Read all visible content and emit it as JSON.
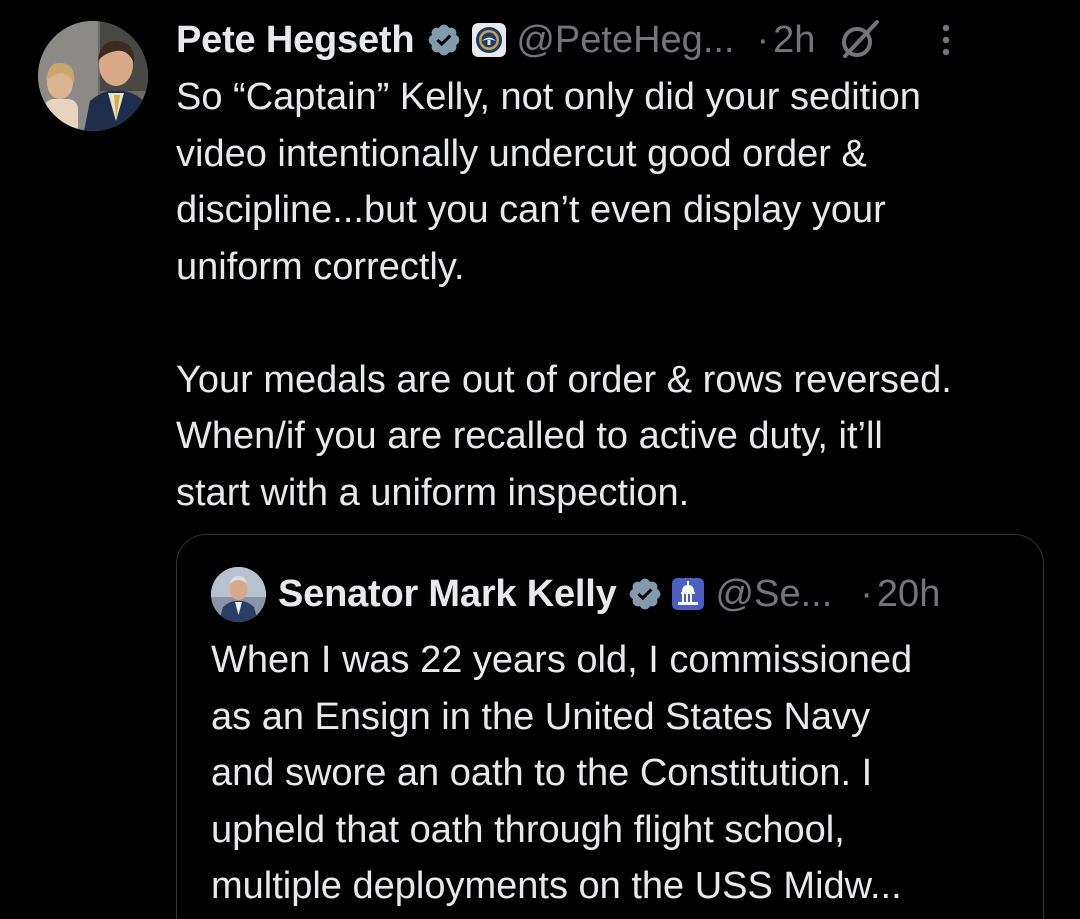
{
  "post": {
    "author": {
      "display_name": "Pete Hegseth",
      "handle": "@PeteHeg...",
      "verified_icon": "verified-badge-icon",
      "affiliate_icon": "dod-seal-icon"
    },
    "separator": "·",
    "time": "2h",
    "grok_icon": "grok-icon",
    "more_icon": "more-vertical-icon",
    "text": "So “Captain” Kelly, not only did your sedition\nvideo intentionally undercut good order &\ndiscipline...but you can’t even display your\nuniform correctly.\n\nYour medals are out of order & rows reversed.\nWhen/if you are recalled to active duty, it’ll\nstart with a uniform inspection."
  },
  "quoted_post": {
    "author": {
      "display_name": "Senator Mark Kelly",
      "handle": "@Se...",
      "verified_icon": "verified-badge-icon",
      "affiliate_icon": "capitol-icon"
    },
    "separator": "·",
    "time": "20h",
    "text": "When I was 22 years old, I commissioned\nas an Ensign in the United States Navy\nand swore an oath to the Constitution. I\nupheld that oath through flight school,\nmultiple deployments on the USS Midw..."
  },
  "colors": {
    "background": "#000000",
    "text_primary": "#e7e9ea",
    "text_secondary": "#71767b",
    "border": "#2f3336",
    "verified_badge": "#829aab"
  }
}
